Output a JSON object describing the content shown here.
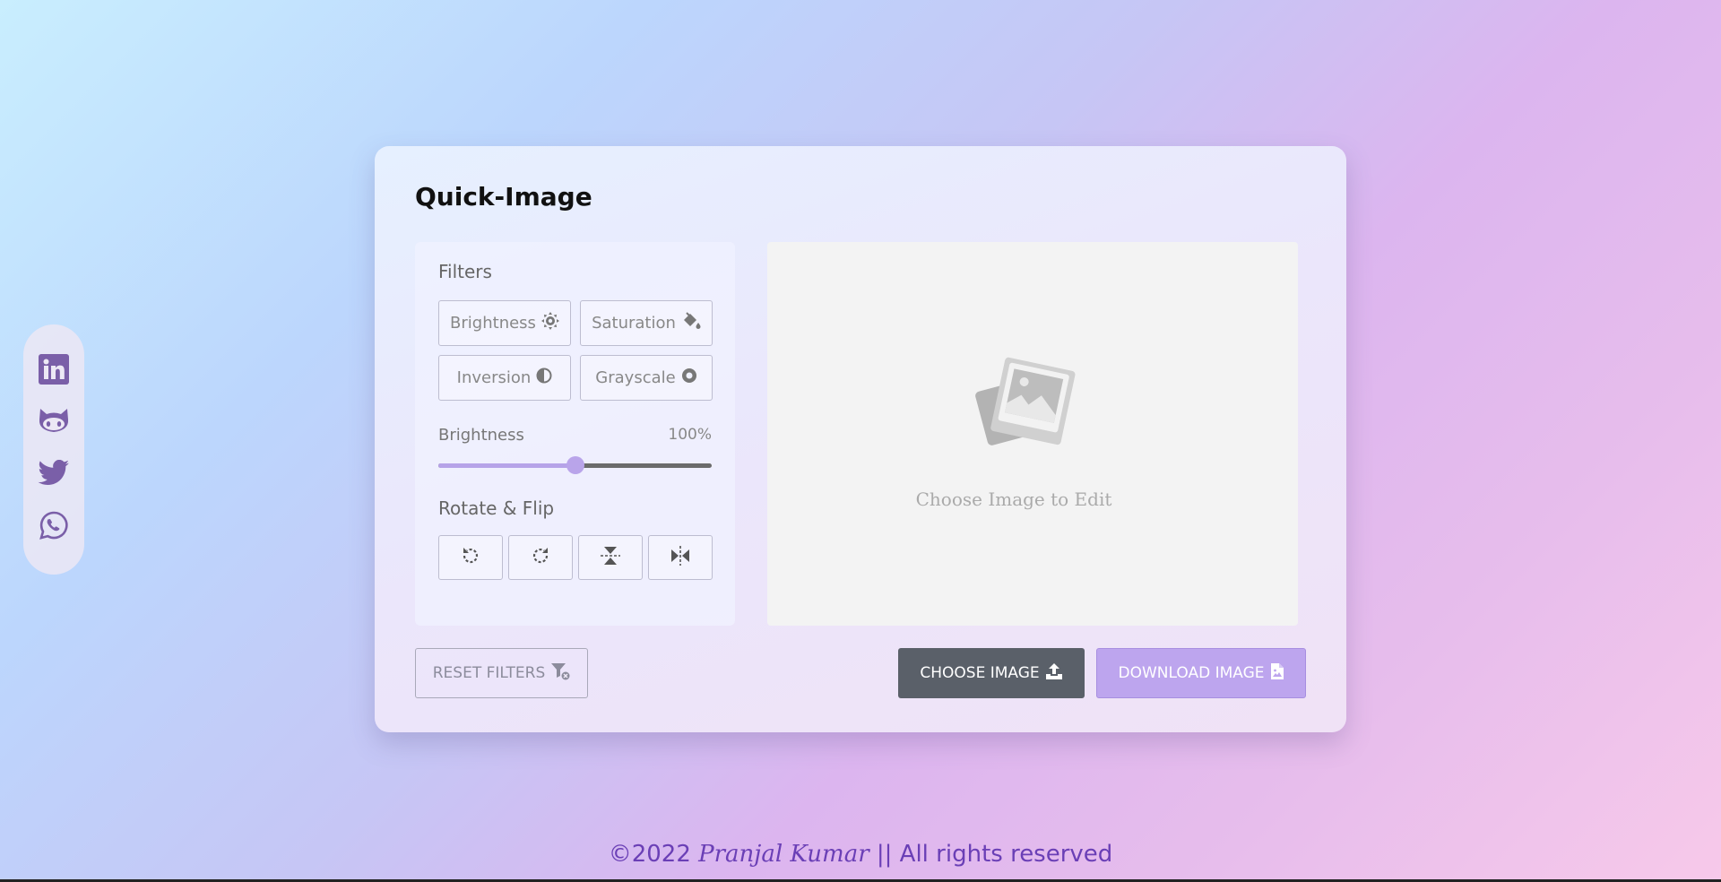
{
  "app": {
    "title": "Quick-Image"
  },
  "colors": {
    "accent": "#bda5ee",
    "dark_button": "#5a6069",
    "social_icon": "#7a5fa8",
    "footer_text": "#6a3fb6"
  },
  "social": [
    {
      "name": "linkedin",
      "icon": "linkedin-icon"
    },
    {
      "name": "github",
      "icon": "github-icon"
    },
    {
      "name": "twitter",
      "icon": "twitter-icon"
    },
    {
      "name": "whatsapp",
      "icon": "whatsapp-icon"
    }
  ],
  "filters": {
    "heading": "Filters",
    "buttons": [
      {
        "label": "Brightness",
        "icon": "sun-gear-icon"
      },
      {
        "label": "Saturation",
        "icon": "paint-bucket-icon"
      },
      {
        "label": "Inversion",
        "icon": "half-circle-icon"
      },
      {
        "label": "Grayscale",
        "icon": "dot-circle-icon"
      }
    ]
  },
  "slider": {
    "label": "Brightness",
    "value_text": "100%",
    "value": 100,
    "max": 200
  },
  "rotate": {
    "heading": "Rotate & Flip",
    "buttons": [
      {
        "icon": "rotate-left-icon"
      },
      {
        "icon": "rotate-right-icon"
      },
      {
        "icon": "flip-vertical-icon"
      },
      {
        "icon": "flip-horizontal-icon"
      }
    ]
  },
  "preview": {
    "placeholder": "Choose Image to Edit",
    "icon": "image-placeholder-icon"
  },
  "actions": {
    "reset": "RESET FILTERS",
    "choose": "CHOOSE IMAGE",
    "download": "DOWNLOAD IMAGE"
  },
  "footer": {
    "prefix": "©2022 ",
    "author": "Pranjal Kumar",
    "suffix": " || All rights reserved"
  }
}
